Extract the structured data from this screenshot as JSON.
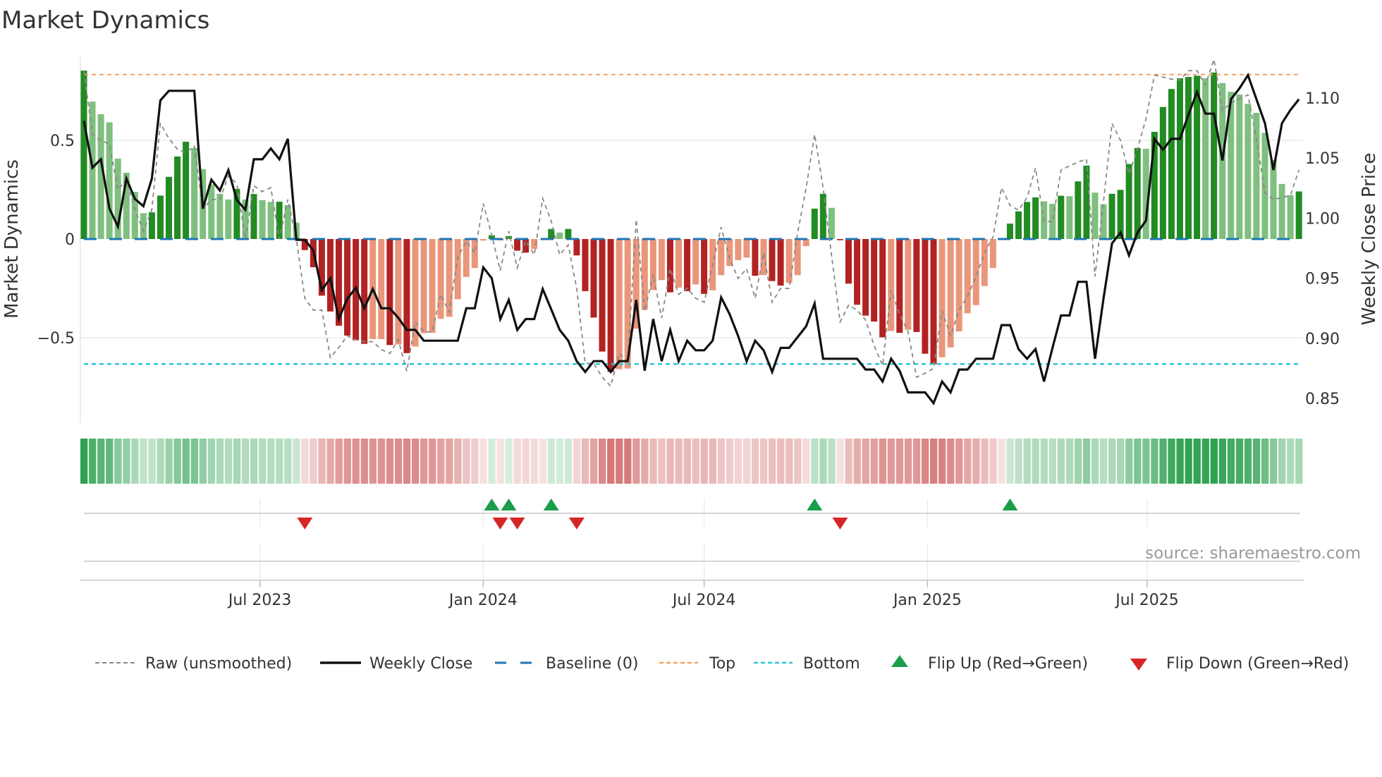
{
  "title": "Market Dynamics",
  "source": "source: sharemaestro.com",
  "colors": {
    "strong_green": "#228b22",
    "weak_green": "#7fbf7f",
    "strong_red": "#b22222",
    "weak_red": "#e9967a",
    "heat_green": "#2ea050",
    "heat_red": "#cd5c5c",
    "close": "#111111",
    "raw": "#888888",
    "baseline": "#1f77b4",
    "top": "#f4a261",
    "bottom": "#2ec4d6",
    "flip_up": "#1a9e4a",
    "flip_down": "#d62728"
  },
  "chart_data": {
    "type": "bar",
    "title": "Market Dynamics",
    "ylabel": "Market Dynamics",
    "y2label": "Weekly Close Price",
    "x_start": "2023-02-06",
    "x_step_days": 7,
    "ylim": [
      -0.93,
      0.925
    ],
    "y2lim": [
      0.79,
      1.145
    ],
    "yticks": [
      {
        "v": 0.5,
        "label": "0.5"
      },
      {
        "v": 0,
        "label": "0"
      },
      {
        "v": -0.5,
        "label": "−0.5"
      }
    ],
    "y2ticks": [
      {
        "v": 1.1,
        "label": "1.10"
      },
      {
        "v": 1.05,
        "label": "1.05"
      },
      {
        "v": 1.0,
        "label": "1.00"
      },
      {
        "v": 0.95,
        "label": "0.95"
      },
      {
        "v": 0.9,
        "label": "0.90"
      },
      {
        "v": 0.85,
        "label": "0.85"
      }
    ],
    "xticks": [
      {
        "date": "2023-07-01",
        "label": "Jul 2023"
      },
      {
        "date": "2024-01-01",
        "label": "Jan 2024"
      },
      {
        "date": "2024-07-01",
        "label": "Jul 2024"
      },
      {
        "date": "2025-01-01",
        "label": "Jan 2025"
      },
      {
        "date": "2025-07-01",
        "label": "Jul 2025"
      }
    ],
    "top_level": 0.833,
    "bottom_level": -0.633,
    "baseline": 0,
    "grid": true,
    "legend_position": "bottom",
    "legend": [
      {
        "key": "raw",
        "label": "Raw (unsmoothed)"
      },
      {
        "key": "close",
        "label": "Weekly Close"
      },
      {
        "key": "baseline",
        "label": "Baseline (0)"
      },
      {
        "key": "top",
        "label": "Top"
      },
      {
        "key": "bottom",
        "label": "Bottom"
      },
      {
        "key": "flip_up",
        "label": "Flip Up (Red→Green)"
      },
      {
        "key": "flip_down",
        "label": "Flip Down (Green→Red)"
      }
    ],
    "dynamics": [
      0.853,
      0.696,
      0.632,
      0.591,
      0.407,
      0.336,
      0.239,
      0.131,
      0.135,
      0.22,
      0.315,
      0.418,
      0.493,
      0.461,
      0.354,
      0.277,
      0.229,
      0.2,
      0.254,
      0.2,
      0.228,
      0.197,
      0.188,
      0.189,
      0.172,
      0.083,
      -0.056,
      -0.143,
      -0.287,
      -0.367,
      -0.439,
      -0.489,
      -0.513,
      -0.531,
      -0.507,
      -0.507,
      -0.537,
      -0.534,
      -0.578,
      -0.545,
      -0.477,
      -0.475,
      -0.404,
      -0.394,
      -0.305,
      -0.192,
      -0.147,
      -0.008,
      0.019,
      -0.006,
      0.015,
      -0.059,
      -0.069,
      -0.05,
      -0.003,
      0.051,
      0.033,
      0.051,
      -0.083,
      -0.264,
      -0.398,
      -0.57,
      -0.673,
      -0.659,
      -0.656,
      -0.454,
      -0.359,
      -0.258,
      -0.208,
      -0.27,
      -0.246,
      -0.264,
      -0.23,
      -0.278,
      -0.26,
      -0.183,
      -0.137,
      -0.107,
      -0.094,
      -0.186,
      -0.183,
      -0.213,
      -0.236,
      -0.222,
      -0.183,
      -0.036,
      0.154,
      0.229,
      0.158,
      -0.006,
      -0.226,
      -0.333,
      -0.388,
      -0.418,
      -0.498,
      -0.466,
      -0.475,
      -0.46,
      -0.471,
      -0.581,
      -0.634,
      -0.599,
      -0.549,
      -0.468,
      -0.376,
      -0.335,
      -0.238,
      -0.147,
      -0.004,
      0.078,
      0.14,
      0.188,
      0.211,
      0.191,
      0.178,
      0.219,
      0.217,
      0.292,
      0.372,
      0.235,
      0.176,
      0.229,
      0.249,
      0.38,
      0.461,
      0.457,
      0.543,
      0.669,
      0.76,
      0.814,
      0.821,
      0.827,
      0.814,
      0.843,
      0.79,
      0.746,
      0.732,
      0.684,
      0.639,
      0.538,
      0.401,
      0.279,
      0.222,
      0.241
    ],
    "raw": [
      0.85,
      0.53,
      0.5,
      0.48,
      0.25,
      0.3,
      0.15,
      0.04,
      0.15,
      0.585,
      0.51,
      0.455,
      0.437,
      0.47,
      0.15,
      0.2,
      0.2,
      0.32,
      0.28,
      0.0,
      0.27,
      0.24,
      0.26,
      0.0,
      0.2,
      0.0,
      -0.3,
      -0.36,
      -0.36,
      -0.6,
      -0.55,
      -0.49,
      -0.51,
      -0.52,
      -0.52,
      -0.56,
      -0.58,
      -0.51,
      -0.67,
      -0.42,
      -0.47,
      -0.47,
      -0.28,
      -0.37,
      -0.09,
      -0.01,
      -0.07,
      0.18,
      0.02,
      -0.16,
      0.04,
      -0.145,
      -0.01,
      -0.08,
      0.205,
      0.09,
      -0.08,
      -0.03,
      -0.25,
      -0.63,
      -0.63,
      -0.7,
      -0.745,
      -0.58,
      -0.62,
      0.1,
      -0.365,
      -0.18,
      -0.4,
      -0.15,
      -0.28,
      -0.25,
      -0.3,
      -0.32,
      -0.13,
      0.06,
      -0.1,
      -0.2,
      -0.15,
      -0.3,
      -0.07,
      -0.32,
      -0.25,
      -0.25,
      0.03,
      0.26,
      0.53,
      0.26,
      -0.085,
      -0.42,
      -0.335,
      -0.36,
      -0.41,
      -0.54,
      -0.64,
      -0.26,
      -0.38,
      -0.47,
      -0.7,
      -0.68,
      -0.655,
      -0.365,
      -0.49,
      -0.36,
      -0.29,
      -0.19,
      -0.07,
      0.01,
      0.26,
      0.17,
      0.146,
      0.21,
      0.36,
      0.09,
      0.087,
      0.35,
      0.37,
      0.39,
      0.405,
      -0.19,
      0.19,
      0.585,
      0.5,
      0.33,
      0.455,
      0.61,
      0.83,
      0.82,
      0.81,
      0.805,
      0.853,
      0.853,
      0.78,
      0.91,
      0.65,
      0.69,
      0.71,
      0.73,
      0.51,
      0.235,
      0.2,
      0.21,
      0.22,
      0.35
    ],
    "close": [
      1.081,
      1.042,
      1.049,
      1.008,
      0.993,
      1.033,
      1.016,
      1.01,
      1.033,
      1.098,
      1.106,
      1.106,
      1.106,
      1.106,
      1.008,
      1.032,
      1.023,
      1.04,
      1.015,
      1.007,
      1.049,
      1.049,
      1.058,
      1.049,
      1.066,
      0.982,
      0.982,
      0.973,
      0.94,
      0.95,
      0.916,
      0.933,
      0.942,
      0.925,
      0.941,
      0.925,
      0.925,
      0.917,
      0.907,
      0.907,
      0.898,
      0.898,
      0.898,
      0.898,
      0.898,
      0.925,
      0.925,
      0.959,
      0.95,
      0.916,
      0.932,
      0.907,
      0.916,
      0.916,
      0.941,
      0.924,
      0.907,
      0.898,
      0.881,
      0.872,
      0.881,
      0.881,
      0.872,
      0.881,
      0.881,
      0.932,
      0.873,
      0.916,
      0.881,
      0.907,
      0.881,
      0.898,
      0.89,
      0.89,
      0.898,
      0.934,
      0.92,
      0.902,
      0.881,
      0.898,
      0.89,
      0.872,
      0.892,
      0.892,
      0.901,
      0.91,
      0.929,
      0.883,
      0.883,
      0.883,
      0.883,
      0.883,
      0.874,
      0.874,
      0.864,
      0.883,
      0.873,
      0.855,
      0.855,
      0.855,
      0.846,
      0.864,
      0.855,
      0.874,
      0.874,
      0.883,
      0.883,
      0.883,
      0.911,
      0.911,
      0.891,
      0.883,
      0.891,
      0.864,
      0.892,
      0.919,
      0.919,
      0.947,
      0.947,
      0.883,
      0.933,
      0.979,
      0.988,
      0.969,
      0.988,
      0.998,
      1.066,
      1.057,
      1.066,
      1.066,
      1.086,
      1.105,
      1.087,
      1.087,
      1.048,
      1.099,
      1.108,
      1.119,
      1.099,
      1.079,
      1.04,
      1.079,
      1.09,
      1.099
    ]
  }
}
